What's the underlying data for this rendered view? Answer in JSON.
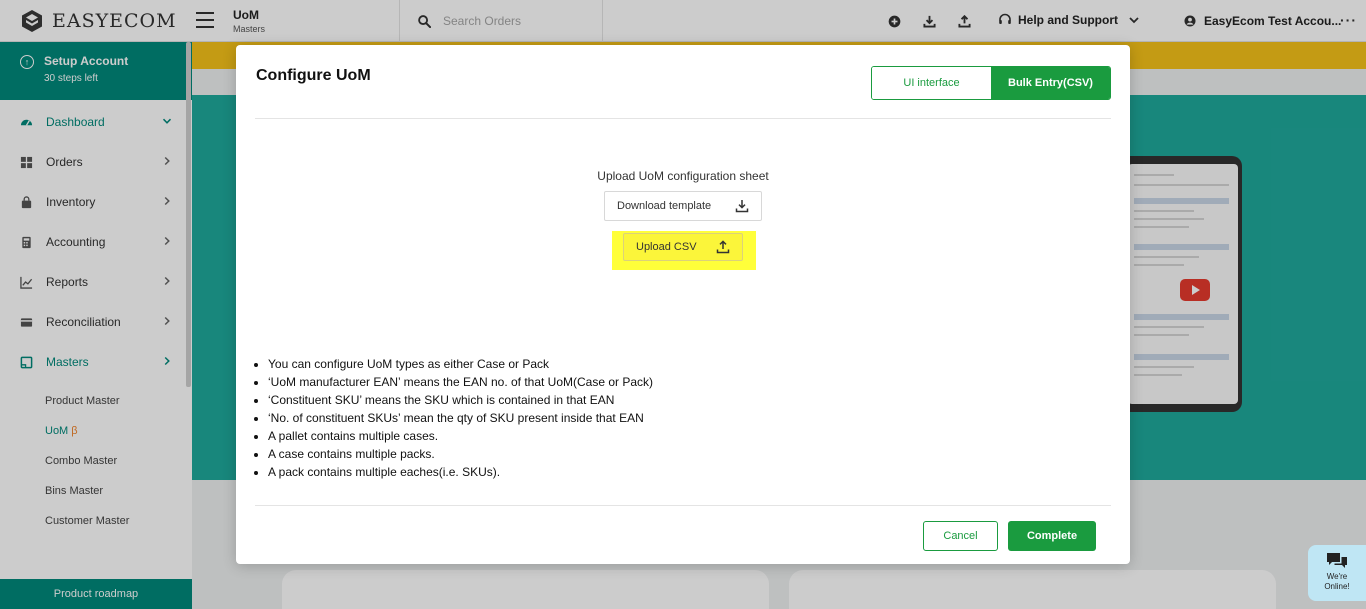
{
  "topbar": {
    "brand": "EASYECOM",
    "page_title": "UoM",
    "page_subtitle": "Masters",
    "search_placeholder": "Search Orders",
    "help_label": "Help and Support",
    "account_label": "EasyEcom Test Accou...",
    "more_label": "···"
  },
  "sidebar": {
    "setup": {
      "title": "Setup Account",
      "subtitle": "30 steps left"
    },
    "items": [
      {
        "label": "Dashboard",
        "icon": "dashboard-icon"
      },
      {
        "label": "Orders",
        "icon": "orders-icon"
      },
      {
        "label": "Inventory",
        "icon": "inventory-icon"
      },
      {
        "label": "Accounting",
        "icon": "accounting-icon"
      },
      {
        "label": "Reports",
        "icon": "reports-icon"
      },
      {
        "label": "Reconciliation",
        "icon": "reconciliation-icon"
      },
      {
        "label": "Masters",
        "icon": "masters-icon"
      }
    ],
    "sub_items": [
      {
        "label": "Product Master"
      },
      {
        "label": "UoM",
        "badge": "β"
      },
      {
        "label": "Combo Master"
      },
      {
        "label": "Bins Master"
      },
      {
        "label": "Customer Master"
      }
    ],
    "roadmap_label": "Product roadmap"
  },
  "modal": {
    "title": "Configure UoM",
    "toggle": {
      "ui_label": "UI interface",
      "bulk_label": "Bulk Entry(CSV)"
    },
    "upload_title": "Upload UoM configuration sheet",
    "download_label": "Download template",
    "upload_label": "Upload CSV",
    "notes": [
      "You can configure UoM types as either Case or Pack",
      "‘UoM manufacturer EAN’ means the EAN no. of that UoM(Case or Pack)",
      "‘Constituent SKU’ means the SKU which is contained in that EAN",
      "‘No. of constituent SKUs’ mean the qty of SKU present inside that EAN",
      "A pallet contains multiple cases.",
      "A case contains multiple packs.",
      "A pack contains multiple eaches(i.e. SKUs)."
    ],
    "cancel_label": "Cancel",
    "complete_label": "Complete"
  },
  "chat": {
    "label": "We're Online!"
  },
  "colors": {
    "teal": "#00897b",
    "green": "#1a9b3f",
    "highlight": "#ffff3a",
    "banner": "#f6c21a",
    "hero": "#1fa99c"
  }
}
